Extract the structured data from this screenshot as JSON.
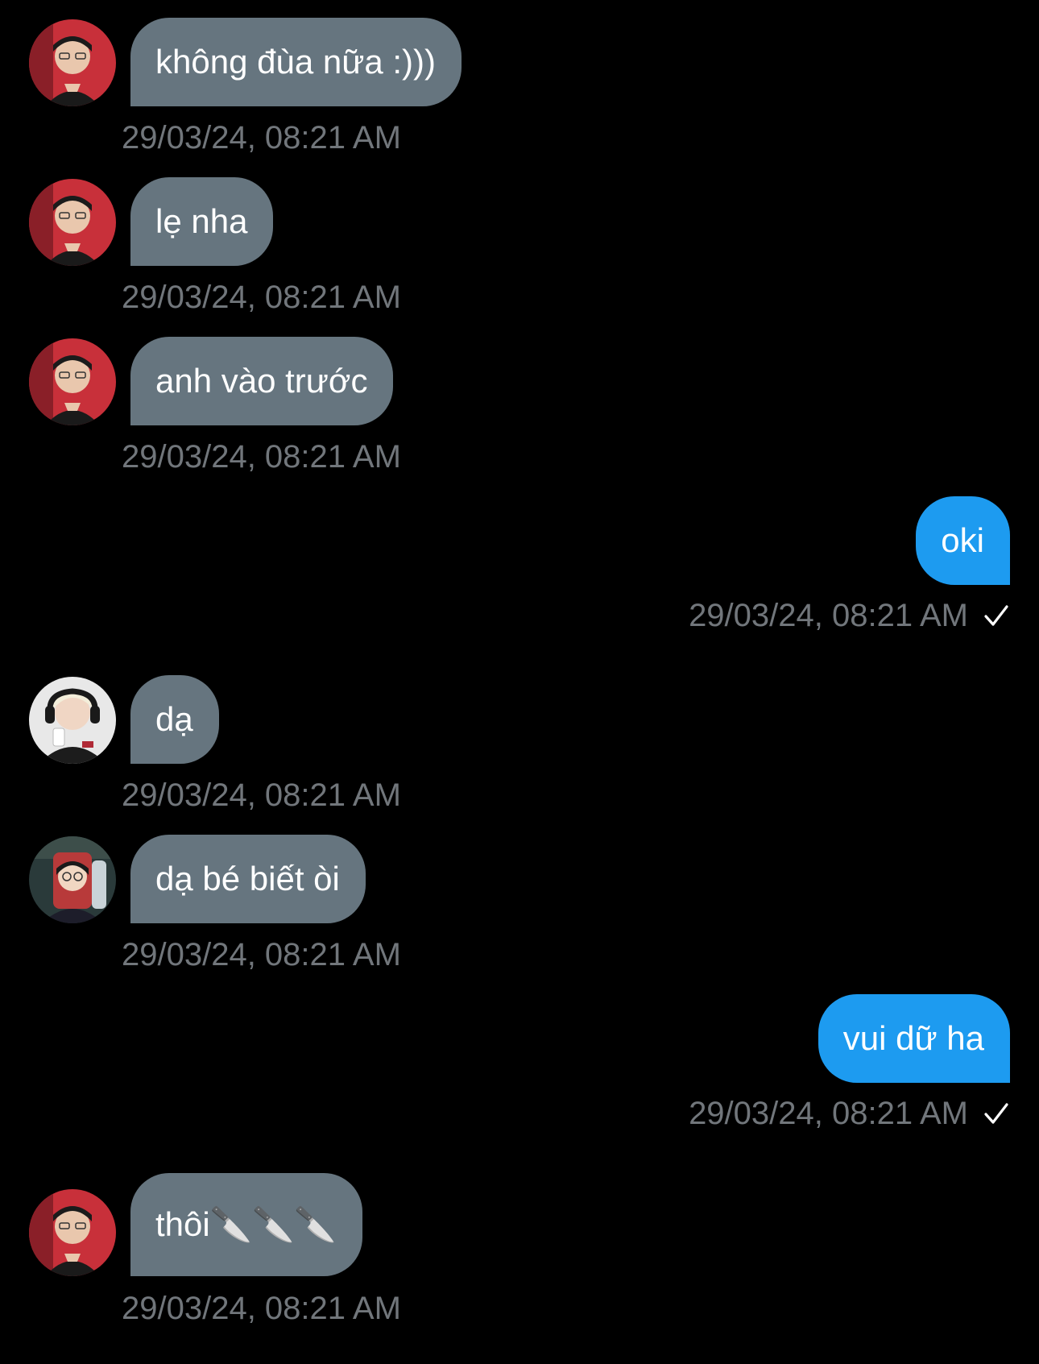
{
  "colors": {
    "background": "#000000",
    "incoming_bubble": "#66757f",
    "outgoing_bubble": "#1d9bf0",
    "timestamp": "#71767b"
  },
  "messages": [
    {
      "direction": "incoming",
      "avatar": "avatar-a",
      "text": "không đùa nữa :)))",
      "time": "29/03/24, 08:21 AM"
    },
    {
      "direction": "incoming",
      "avatar": "avatar-a",
      "text": "lẹ nha",
      "time": "29/03/24, 08:21 AM"
    },
    {
      "direction": "incoming",
      "avatar": "avatar-a",
      "text": "anh vào trước",
      "time": "29/03/24, 08:21 AM"
    },
    {
      "direction": "outgoing",
      "text": "oki",
      "time": "29/03/24, 08:21 AM",
      "status_icon": "check-icon"
    },
    {
      "direction": "incoming",
      "avatar": "avatar-b",
      "text": "dạ",
      "time": "29/03/24, 08:21 AM"
    },
    {
      "direction": "incoming",
      "avatar": "avatar-c",
      "text": "dạ bé biết òi",
      "time": "29/03/24, 08:21 AM"
    },
    {
      "direction": "outgoing",
      "text": "vui dữ ha",
      "time": "29/03/24, 08:21 AM",
      "status_icon": "check-icon"
    },
    {
      "direction": "incoming",
      "avatar": "avatar-a",
      "text": "thôi🔪🔪🔪",
      "time": "29/03/24, 08:21 AM"
    }
  ]
}
